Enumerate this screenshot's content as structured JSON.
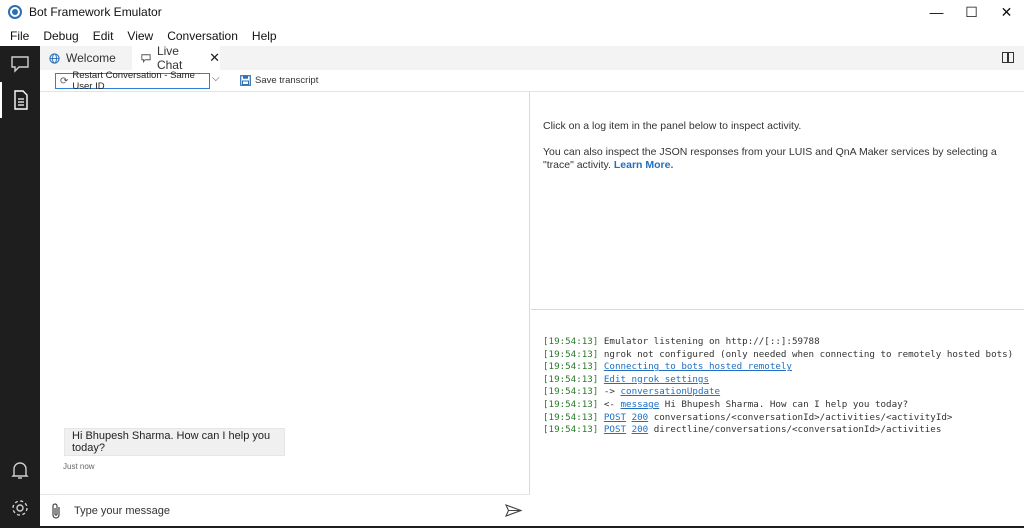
{
  "window": {
    "title": "Bot Framework Emulator",
    "minimize_symbol": "—",
    "maximize_symbol": "☐",
    "close_symbol": "✕"
  },
  "menu": [
    "File",
    "Debug",
    "Edit",
    "View",
    "Conversation",
    "Help"
  ],
  "tabs": {
    "welcome": "Welcome",
    "live_chat": "Live Chat",
    "close_symbol": "✕"
  },
  "toolbar": {
    "restart_label": "Restart Conversation - Same User ID",
    "caret": "⌵",
    "save_transcript": "Save transcript"
  },
  "chat": {
    "bot_message": "Hi Bhupesh Sharma. How can I help you today?",
    "timestamp": "Just now",
    "input_placeholder": "Type your message"
  },
  "inspector": {
    "line1": "Click on a log item in the panel below to inspect activity.",
    "line2": "You can also inspect the JSON responses from your LUIS and QnA Maker services by selecting a \"trace\" activity.",
    "learn_more": "Learn More."
  },
  "log": [
    {
      "time": "[19:54:13]",
      "text": "Emulator listening on http://[::]:59788"
    },
    {
      "time": "[19:54:13]",
      "text": "ngrok not configured (only needed when connecting to remotely hosted bots)"
    },
    {
      "time": "[19:54:13]",
      "link": "Connecting to bots hosted remotely"
    },
    {
      "time": "[19:54:13]",
      "link": "Edit ngrok settings"
    },
    {
      "time": "[19:54:13]",
      "arrow": "->",
      "link": "conversationUpdate"
    },
    {
      "time": "[19:54:13]",
      "arrow": "<-",
      "link": "message",
      "text": "Hi Bhupesh Sharma. How can I help you today?"
    },
    {
      "time": "[19:54:13]",
      "link": "POST",
      "code": "200",
      "text": "conversations/<conversationId>/activities/<activityId>"
    },
    {
      "time": "[19:54:13]",
      "link": "POST",
      "code": "200",
      "text": "directline/conversations/<conversationId>/activities"
    }
  ],
  "icons": {
    "activity_chat": "chat-bubble-icon",
    "activity_transcript": "document-icon",
    "activity_notifications": "bell-icon",
    "activity_settings": "gear-icon",
    "welcome_tab": "globe-icon",
    "live_chat_tab": "chat-bubble-icon",
    "attach": "paperclip-icon",
    "send": "send-icon"
  },
  "colors": {
    "activity_bar": "#1e1e1e",
    "accent": "#1f6fc4",
    "log_time": "#2a7a2a"
  }
}
